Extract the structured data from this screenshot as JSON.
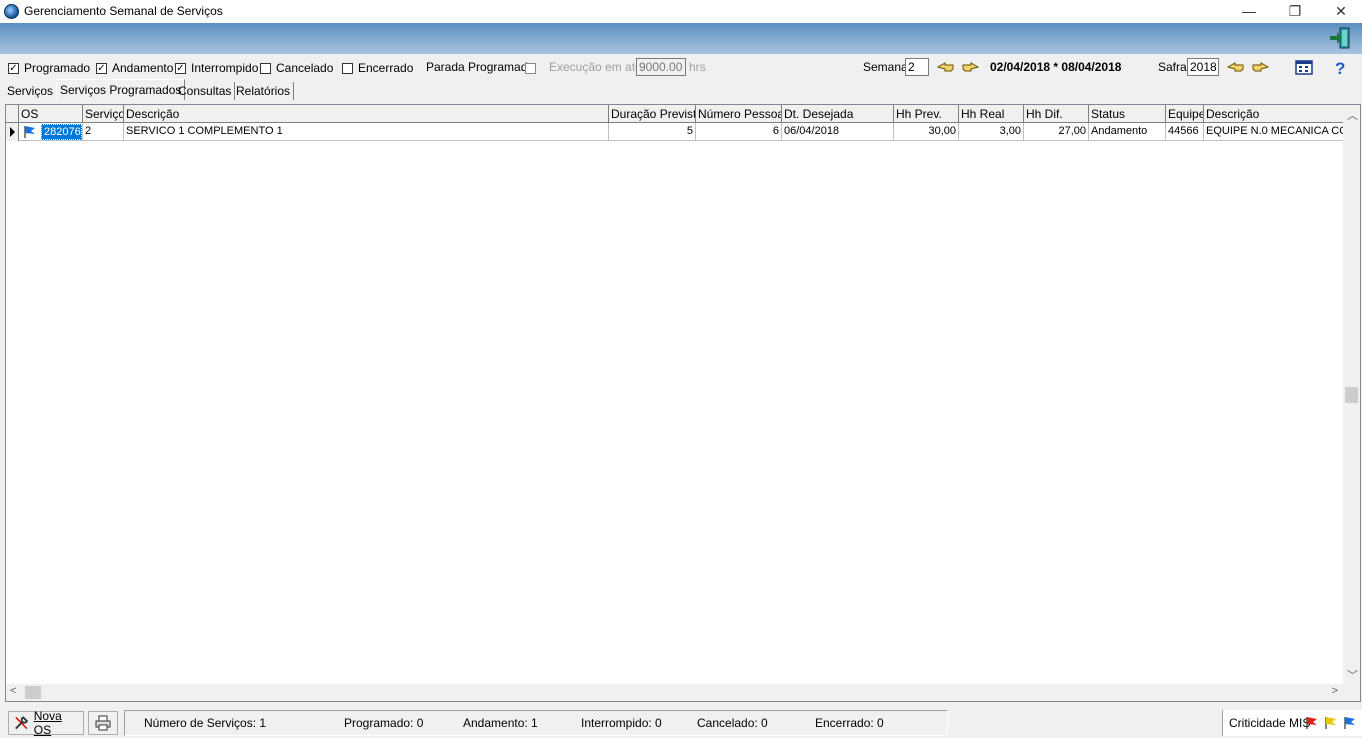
{
  "window": {
    "title": "Gerenciamento Semanal de Serviços",
    "minimize": "—",
    "restore": "❐",
    "close": "✕"
  },
  "filters": {
    "programado": {
      "label": "Programado",
      "checked": true
    },
    "andamento": {
      "label": "Andamento",
      "checked": true
    },
    "interrompido": {
      "label": "Interrompido",
      "checked": true
    },
    "cancelado": {
      "label": "Cancelado",
      "checked": false
    },
    "encerrado": {
      "label": "Encerrado",
      "checked": false
    },
    "parada_label": "Parada Programada",
    "execucao_label": "Execução em até",
    "execucao_value": "9000.00",
    "execucao_unit": "hrs",
    "semana_label": "Semana",
    "semana_value": "2",
    "date_range": "02/04/2018 * 08/04/2018",
    "safra_label": "Safra",
    "safra_value": "2018",
    "check_mark": "✓"
  },
  "tabs": [
    "Serviços",
    "Serviços Programados",
    "Consultas",
    "Relatórios"
  ],
  "active_tab": "Serviços Programados",
  "grid": {
    "columns": [
      "OS",
      "Serviço",
      "Descrição",
      "Duração Prevista",
      "Número Pessoas",
      "Dt. Desejada",
      "Hh Prev.",
      "Hh Real",
      "Hh Dif.",
      "Status",
      "Equipe",
      "Descrição"
    ],
    "rows": [
      {
        "os": "282076",
        "servico": "2",
        "descricao": "SERVICO 1 COMPLEMENTO 1",
        "duracao": "5",
        "pessoas": "6",
        "dt_desejada": "06/04/2018",
        "hh_prev": "30,00",
        "hh_real": "3,00",
        "hh_dif": "27,00",
        "status": "Andamento",
        "equipe": "44566",
        "equipe_desc": "EQUIPE N.0 MECANICA CO"
      }
    ]
  },
  "statusbar": {
    "nova_os": "Nova OS",
    "num_servicos": "Número de Serviços: 1",
    "programado": "Programado: 0",
    "andamento": "Andamento: 1",
    "interrompido": "Interrompido: 0",
    "cancelado": "Cancelado: 0",
    "encerrado": "Encerrado: 0",
    "criticidade": "Criticidade MIS"
  },
  "colors": {
    "flag_red": "#e02020",
    "flag_yellow": "#e8c800",
    "flag_blue": "#1e6fd9",
    "selection": "#0078d7"
  },
  "icons": [
    "app-icon",
    "exit-icon",
    "hand-left-icon",
    "hand-right-icon",
    "calendar-icon",
    "help-icon",
    "print-icon",
    "flag-icon"
  ]
}
